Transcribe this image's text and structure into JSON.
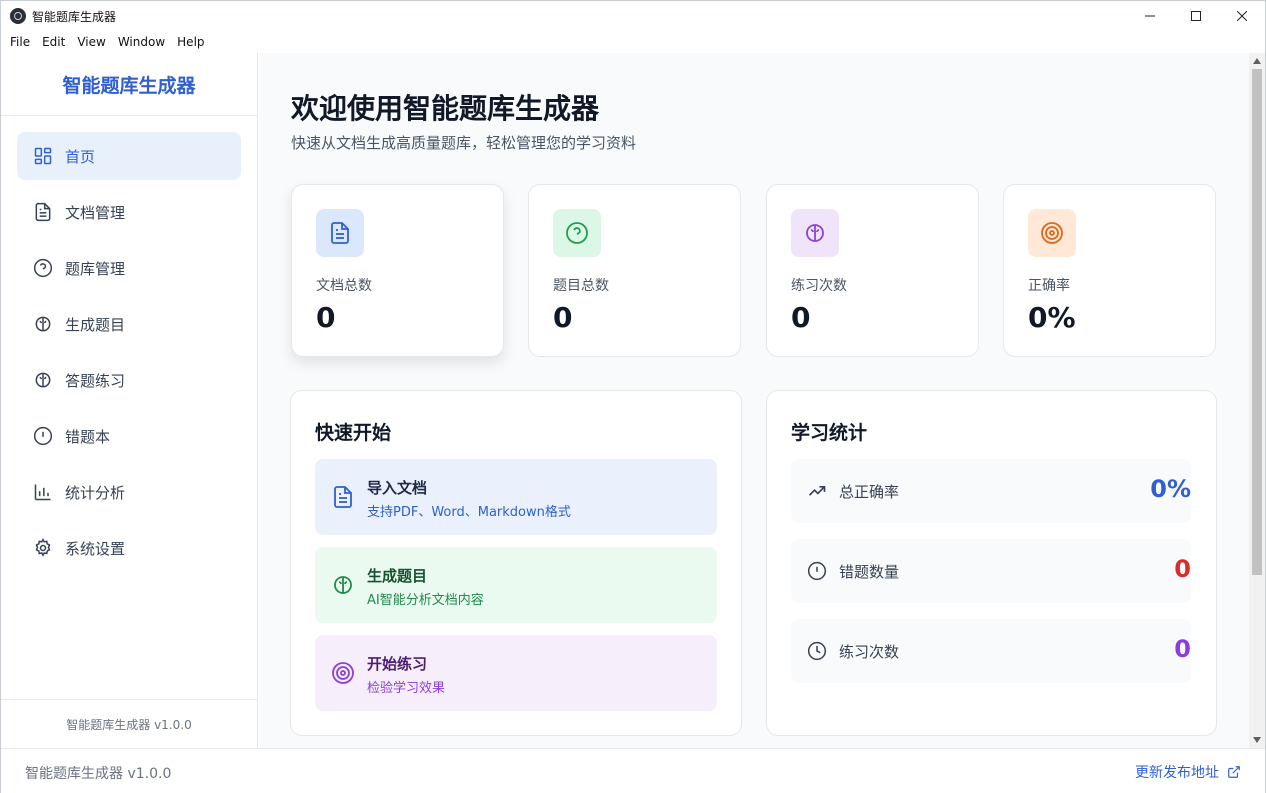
{
  "window": {
    "title": "智能题库生成器"
  },
  "menu": [
    "File",
    "Edit",
    "View",
    "Window",
    "Help"
  ],
  "sidebar": {
    "brand": "智能题库生成器",
    "items": [
      {
        "label": "首页",
        "icon": "dashboard-icon",
        "active": true
      },
      {
        "label": "文档管理",
        "icon": "document-icon"
      },
      {
        "label": "题库管理",
        "icon": "question-circle-icon"
      },
      {
        "label": "生成题目",
        "icon": "brain-icon"
      },
      {
        "label": "答题练习",
        "icon": "brain-icon"
      },
      {
        "label": "错题本",
        "icon": "alert-circle-icon"
      },
      {
        "label": "统计分析",
        "icon": "bar-chart-icon"
      },
      {
        "label": "系统设置",
        "icon": "gear-icon"
      }
    ],
    "footer": "智能题库生成器 v1.0.0"
  },
  "main": {
    "title": "欢迎使用智能题库生成器",
    "subtitle": "快速从文档生成高质量题库，轻松管理您的学习资料",
    "stats": [
      {
        "label": "文档总数",
        "value": "0",
        "icon": "document-icon",
        "color": "#2f5fd0",
        "bg": "#dbe7fb"
      },
      {
        "label": "题目总数",
        "value": "0",
        "icon": "question-circle-icon",
        "color": "#1f9d55",
        "bg": "#dcf7e6"
      },
      {
        "label": "练习次数",
        "value": "0",
        "icon": "brain-icon",
        "color": "#8b3fd9",
        "bg": "#f0e4fb"
      },
      {
        "label": "正确率",
        "value": "0%",
        "icon": "target-icon",
        "color": "#e0661a",
        "bg": "#ffe9d6"
      }
    ],
    "quick_start": {
      "title": "快速开始",
      "actions": [
        {
          "title": "导入文档",
          "desc": "支持PDF、Word、Markdown格式",
          "icon": "document-icon",
          "color": "#2f5fd0",
          "bg": "#eaf1fd"
        },
        {
          "title": "生成题目",
          "desc": "AI智能分析文档内容",
          "icon": "brain-icon",
          "color": "#1f8a4c",
          "bg": "#eafaf0"
        },
        {
          "title": "开始练习",
          "desc": "检验学习效果",
          "icon": "target-icon",
          "color": "#8b3fd9",
          "bg": "#f7eefc"
        }
      ]
    },
    "learning_stats": {
      "title": "学习统计",
      "rows": [
        {
          "label": "总正确率",
          "value": "0%",
          "icon": "trending-up-icon",
          "color": "#2f5fd0"
        },
        {
          "label": "错题数量",
          "value": "0",
          "icon": "alert-circle-icon",
          "color": "#d62e2e"
        },
        {
          "label": "练习次数",
          "value": "0",
          "icon": "clock-icon",
          "color": "#8b3fd9"
        }
      ]
    }
  },
  "statusbar": {
    "version": "智能题库生成器 v1.0.0",
    "link": "更新发布地址"
  }
}
